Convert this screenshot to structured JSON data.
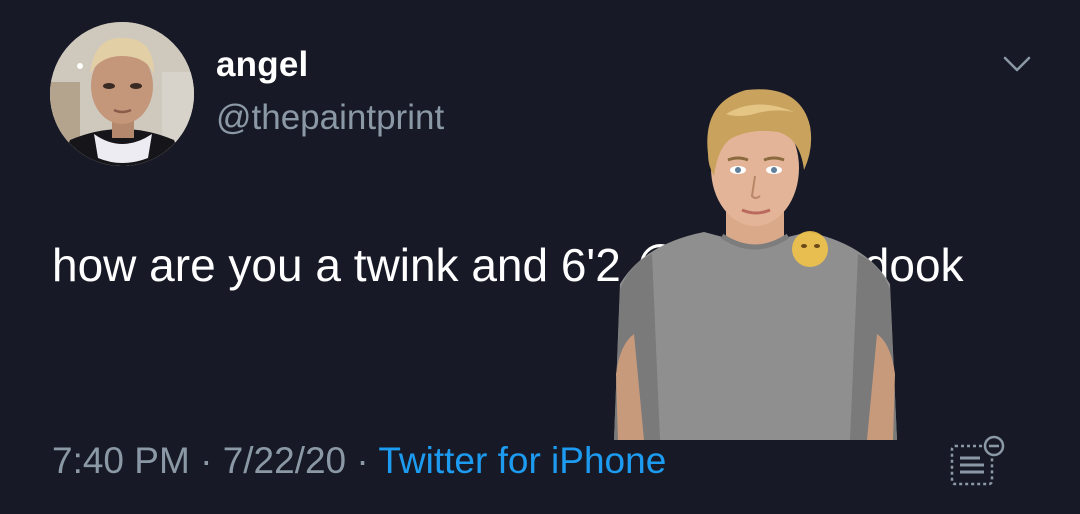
{
  "tweet": {
    "display_name": "angel",
    "handle": "@thepaintprint",
    "text": "how are you a twink and 6'2 😭 ok babadook",
    "time": "7:40 PM",
    "separator": " · ",
    "date": "7/22/20",
    "source": "Twitter for iPhone"
  },
  "icons": {
    "menu": "chevron-down-icon",
    "analytics": "analytics-icon"
  },
  "colors": {
    "background": "#171a26",
    "primary_text": "#ffffff",
    "secondary_text": "#8b98a5",
    "link": "#1d9bf0"
  }
}
